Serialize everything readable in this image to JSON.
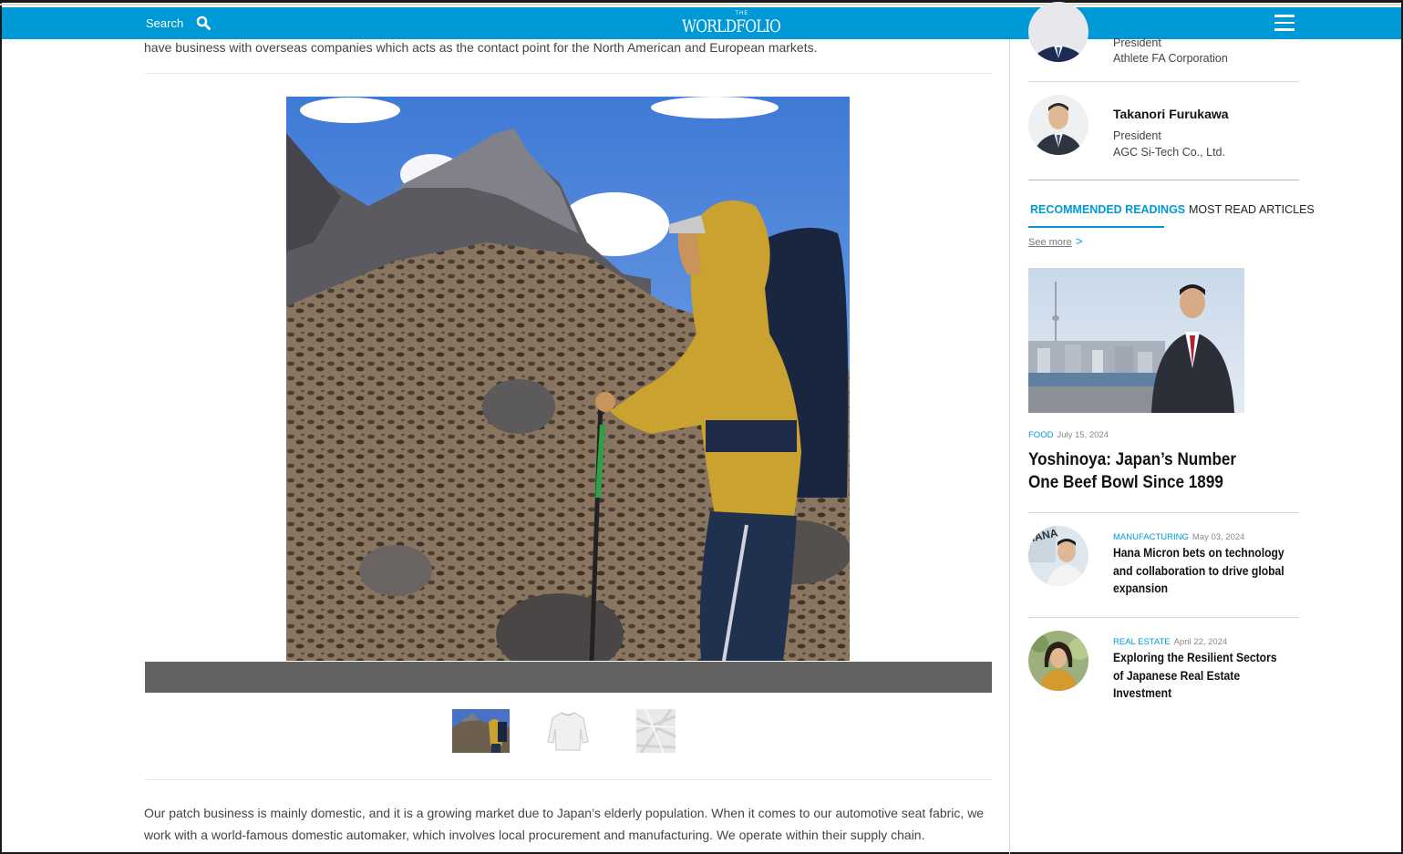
{
  "header": {
    "search_label": "Search",
    "logo_small": "THE",
    "logo_main": "WORLDFOLIO",
    "brand_color": "#0099d8"
  },
  "main": {
    "lead_text": "have business with overseas companies which acts as the contact point for the North American and European markets.",
    "body_text": "Our patch business is mainly domestic, and it is a growing market due to Japan’s elderly population. When it comes to our automotive seat fabric, we work with a world-famous domestic automaker, which involves local procurement and manufacturing. We operate within their supply chain."
  },
  "sidebar": {
    "people": [
      {
        "name": "",
        "role": "President",
        "company": "Athlete FA Corporation"
      },
      {
        "name": "Takanori Furukawa",
        "role": "President",
        "company": "AGC Si-Tech Co., Ltd."
      }
    ],
    "tabs": {
      "recommended": "RECOMMENDED READINGS",
      "most_read": "MOST READ ARTICLES"
    },
    "see_more": "See more",
    "see_more_arrow": ">",
    "feature": {
      "category": "FOOD",
      "date": "July 15, 2024",
      "title": "Yoshinoya: Japan’s Number One Beef Bowl Since 1899"
    },
    "articles": [
      {
        "category": "MANUFACTURING",
        "date": "May 03, 2024",
        "title": "Hana Micron bets on technology and collaboration to drive global expansion",
        "avatar_text": "HANA"
      },
      {
        "category": "REAL ESTATE",
        "date": "April 22, 2024",
        "title": "Exploring the Resilient Sectors of Japanese Real Estate Investment"
      }
    ]
  }
}
